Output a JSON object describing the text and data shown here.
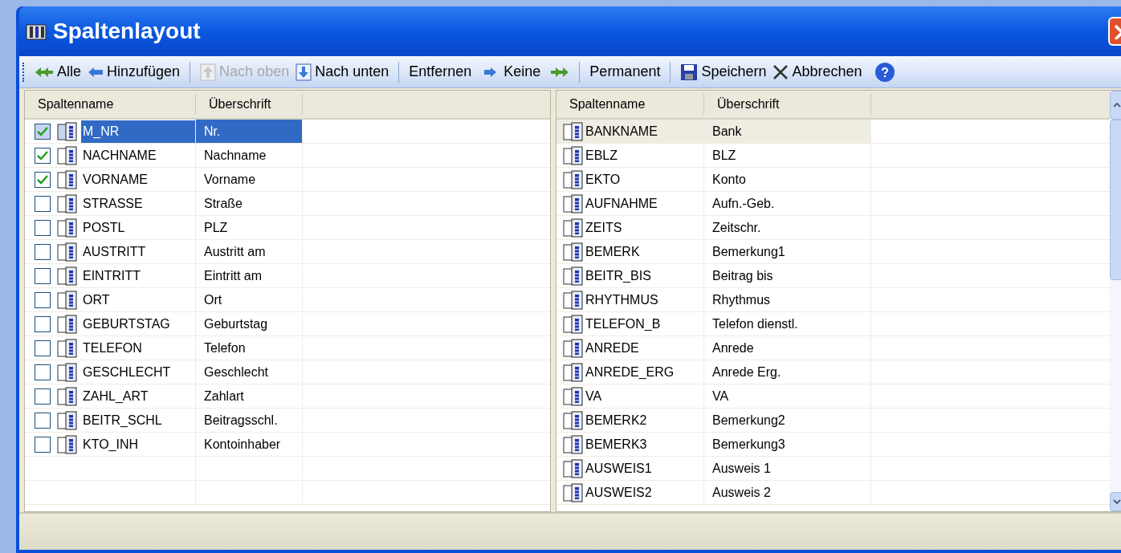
{
  "window": {
    "title": "Spaltenlayout"
  },
  "toolbar": [
    {
      "kind": "all",
      "label": "Alle",
      "disabled": false
    },
    {
      "kind": "add",
      "label": "Hinzufügen",
      "disabled": false
    },
    {
      "kind": "separator"
    },
    {
      "kind": "up",
      "label": "Nach oben",
      "disabled": true
    },
    {
      "kind": "down",
      "label": "Nach unten",
      "disabled": false
    },
    {
      "kind": "separator"
    },
    {
      "kind": "remove",
      "label": "Entfernen",
      "disabled": false
    },
    {
      "kind": "none",
      "label": "Keine",
      "disabled": false
    },
    {
      "kind": "separator"
    },
    {
      "kind": "permanent",
      "label": "Permanent",
      "disabled": false
    },
    {
      "kind": "separator"
    },
    {
      "kind": "save",
      "label": "Speichern",
      "disabled": false
    },
    {
      "kind": "cancel",
      "label": "Abbrechen",
      "disabled": false
    },
    {
      "kind": "help"
    }
  ],
  "left_table": {
    "columns": [
      "Spaltenname",
      "Überschrift"
    ],
    "rows": [
      {
        "checked": true,
        "selected": true,
        "name": "M_NR",
        "heading": "Nr."
      },
      {
        "checked": true,
        "selected": false,
        "name": "NACHNAME",
        "heading": "Nachname"
      },
      {
        "checked": true,
        "selected": false,
        "name": "VORNAME",
        "heading": "Vorname"
      },
      {
        "checked": false,
        "selected": false,
        "name": "STRASSE",
        "heading": "Straße"
      },
      {
        "checked": false,
        "selected": false,
        "name": "POSTL",
        "heading": "PLZ"
      },
      {
        "checked": false,
        "selected": false,
        "name": "AUSTRITT",
        "heading": "Austritt am"
      },
      {
        "checked": false,
        "selected": false,
        "name": "EINTRITT",
        "heading": "Eintritt am"
      },
      {
        "checked": false,
        "selected": false,
        "name": "ORT",
        "heading": "Ort"
      },
      {
        "checked": false,
        "selected": false,
        "name": "GEBURTSTAG",
        "heading": "Geburtstag"
      },
      {
        "checked": false,
        "selected": false,
        "name": "TELEFON",
        "heading": "Telefon"
      },
      {
        "checked": false,
        "selected": false,
        "name": "GESCHLECHT",
        "heading": "Geschlecht"
      },
      {
        "checked": false,
        "selected": false,
        "name": "ZAHL_ART",
        "heading": "Zahlart"
      },
      {
        "checked": false,
        "selected": false,
        "name": "BEITR_SCHL",
        "heading": "Beitragsschl."
      },
      {
        "checked": false,
        "selected": false,
        "name": "KTO_INH",
        "heading": "Kontoinhaber"
      }
    ]
  },
  "right_table": {
    "columns": [
      "Spaltenname",
      "Überschrift"
    ],
    "rows": [
      {
        "selected": true,
        "name": "BANKNAME",
        "heading": "Bank"
      },
      {
        "selected": false,
        "name": "EBLZ",
        "heading": "BLZ"
      },
      {
        "selected": false,
        "name": "EKTO",
        "heading": "Konto"
      },
      {
        "selected": false,
        "name": "AUFNAHME",
        "heading": "Aufn.-Geb."
      },
      {
        "selected": false,
        "name": "ZEITS",
        "heading": "Zeitschr."
      },
      {
        "selected": false,
        "name": "BEMERK",
        "heading": "Bemerkung1"
      },
      {
        "selected": false,
        "name": "BEITR_BIS",
        "heading": "Beitrag bis"
      },
      {
        "selected": false,
        "name": "RHYTHMUS",
        "heading": "Rhythmus"
      },
      {
        "selected": false,
        "name": "TELEFON_B",
        "heading": "Telefon dienstl."
      },
      {
        "selected": false,
        "name": "ANREDE",
        "heading": "Anrede"
      },
      {
        "selected": false,
        "name": "ANREDE_ERG",
        "heading": "Anrede Erg."
      },
      {
        "selected": false,
        "name": "VA",
        "heading": "VA"
      },
      {
        "selected": false,
        "name": "BEMERK2",
        "heading": "Bemerkung2"
      },
      {
        "selected": false,
        "name": "BEMERK3",
        "heading": "Bemerkung3"
      },
      {
        "selected": false,
        "name": "AUSWEIS1",
        "heading": "Ausweis 1"
      },
      {
        "selected": false,
        "name": "AUSWEIS2",
        "heading": "Ausweis 2"
      }
    ]
  }
}
